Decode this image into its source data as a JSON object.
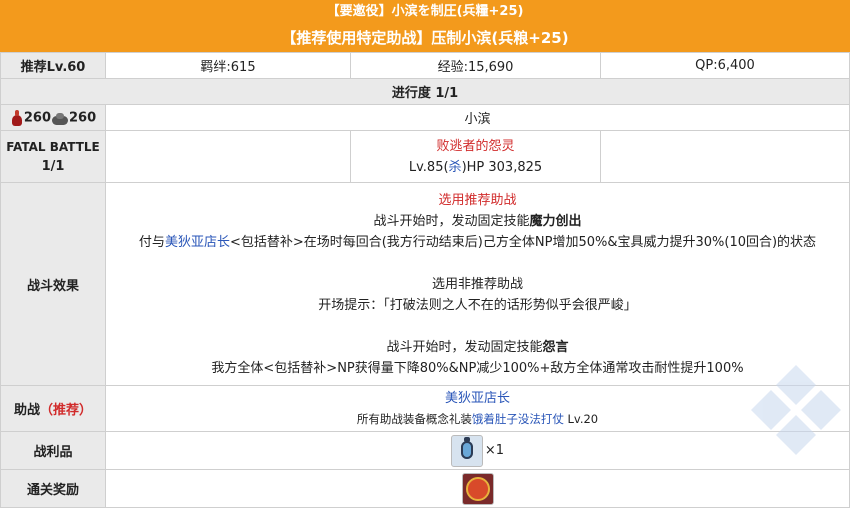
{
  "banner": {
    "top": "【要邀役】小滨を制圧(兵糧+25)",
    "main": "【推荐使用特定助战】压制小滨(兵粮+25)"
  },
  "stats": {
    "level": "推荐Lv.60",
    "bond": "羁绊:615",
    "exp": "经验:15,690",
    "qp": "QP:6,400"
  },
  "progress": "进行度 1/1",
  "ingredients": {
    "red": "260",
    "grey": "260",
    "icon_red": "red-ingredient-icon",
    "icon_grey": "grey-ingredient-icon"
  },
  "location": "小滨",
  "battle": {
    "label_line1": "FATAL BATTLE",
    "label_line2": "1/1",
    "enemy_name": "败逃者的怨灵",
    "enemy_lv": "Lv.85(",
    "enemy_class": "杀",
    "enemy_hp": ")HP 303,825"
  },
  "effects": {
    "label": "战斗效果",
    "sel_rec": "选用推荐助战",
    "start1_pre": "战斗开始时，发动固定技能",
    "skill1": "魔力创出",
    "grant_pre": "付与",
    "grant_servant": "美狄亚店长",
    "grant_post": "<包括替补>在场时每回合(我方行动结束后)己方全体NP增加50%&宝具威力提升30%(10回合)的状态",
    "sel_nonrec": "选用非推荐助战",
    "hint": "开场提示：「打破法则之人不在的话形势似乎会很严峻」",
    "start2_pre": "战斗开始时，发动固定技能",
    "skill2": "怨言",
    "penalty": "我方全体<包括替补>NP获得量下降80%&NP减少100%+敌方全体通常攻击耐性提升100%"
  },
  "support": {
    "label_pre": "助战",
    "label_rec": "（推荐）",
    "servant": "美狄亚店长",
    "ce_pre": "所有助战装备概念礼装",
    "ce_name": "饿着肚子没法打仗",
    "ce_lv": " Lv.20"
  },
  "drops": {
    "label": "战利品",
    "icon": "lantern-icon",
    "qty": "×1"
  },
  "reward": {
    "label": "通关奖励",
    "icon": "reward-icon"
  },
  "colors": {
    "banner": "#f39a1c",
    "header_bg": "#eaeaea",
    "red_text": "#d12b2b",
    "link_blue": "#2a56b8"
  }
}
